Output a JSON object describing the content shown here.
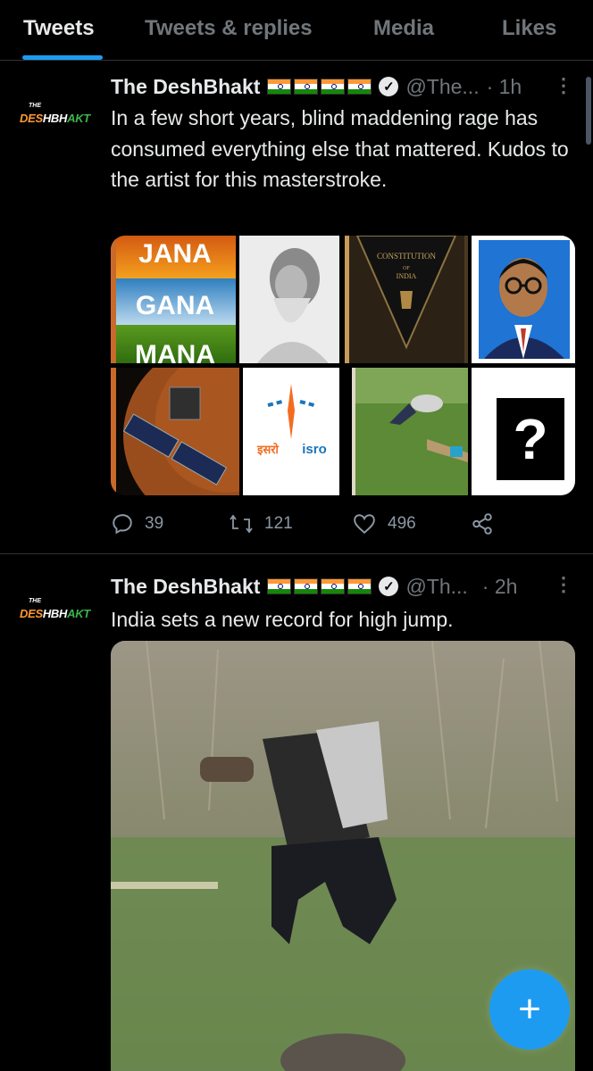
{
  "tabs": [
    {
      "label": "Tweets",
      "active": true
    },
    {
      "label": "Tweets & replies",
      "active": false
    },
    {
      "label": "Media",
      "active": false
    },
    {
      "label": "Likes",
      "active": false
    }
  ],
  "avatar": {
    "small": "THE",
    "brand_1": "DES",
    "brand_2": "HBH",
    "brand_3": "AKT"
  },
  "tweets": [
    {
      "name": "The DeshBhakt",
      "handle": "@The...",
      "time": "· 1h",
      "text": "In a few short years, blind maddening rage has consumed everything else that mattered. Kudos to the artist for this masterstroke.",
      "media": {
        "jana": "JANA",
        "gana": "GANA",
        "mana": "MANA",
        "constitution_title": "CONSTITUTION",
        "constitution_of": "OF",
        "constitution_india": "INDIA",
        "isro_hindi": "इसरो",
        "isro_en": "isro",
        "question": "?"
      },
      "replies": "39",
      "retweets": "121",
      "likes": "496"
    },
    {
      "name": "The DeshBhakt",
      "handle": "@Th...",
      "time": "· 2h",
      "text": "India sets a new record for high jump."
    }
  ],
  "colors": {
    "accent": "#1d9bf0",
    "muted": "#71767b",
    "saffron": "#ff9933",
    "green": "#138808"
  },
  "icons": {
    "reply": "reply-icon",
    "retweet": "retweet-icon",
    "like": "heart-icon",
    "share": "share-icon",
    "verified": "verified-icon",
    "more": "more-icon",
    "compose": "plus-icon"
  }
}
